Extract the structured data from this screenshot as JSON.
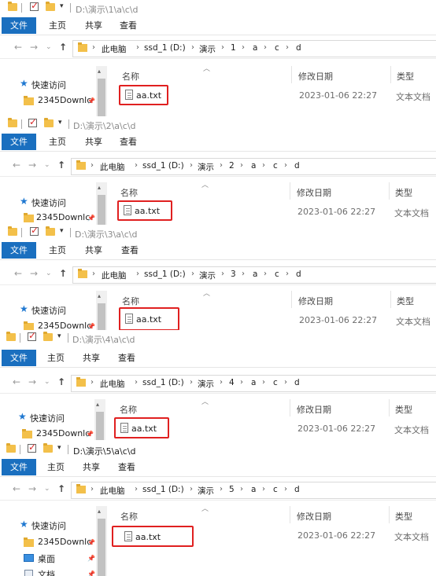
{
  "ribbon": {
    "file": "文件",
    "home": "主页",
    "share": "共享",
    "view": "查看"
  },
  "breadcrumb_fixed": [
    "此电脑",
    "ssd_1 (D:)",
    "演示"
  ],
  "breadcrumb_tail": [
    "a",
    "c",
    "d"
  ],
  "sidebar": {
    "quick_access": "快速访问",
    "downloads": "2345Downlc",
    "desktop": "桌面",
    "documents": "文档"
  },
  "columns": {
    "name": "名称",
    "modified": "修改日期",
    "type": "类型"
  },
  "file": {
    "name": "aa.txt",
    "modified": "2023-01-06 22:27",
    "type": "文本文档"
  },
  "windows": [
    {
      "path": "D:\\演示\\1\\a\\c\\d",
      "folder": "1"
    },
    {
      "path": "D:\\演示\\2\\a\\c\\d",
      "folder": "2"
    },
    {
      "path": "D:\\演示\\3\\a\\c\\d",
      "folder": "3"
    },
    {
      "path": "D:\\演示\\4\\a\\c\\d",
      "folder": "4"
    },
    {
      "path": "D:\\演示\\5\\a\\c\\d",
      "folder": "5"
    }
  ],
  "colors": {
    "accent": "#1a6fbf",
    "highlight": "#e02020",
    "folder": "#f3c04a"
  }
}
